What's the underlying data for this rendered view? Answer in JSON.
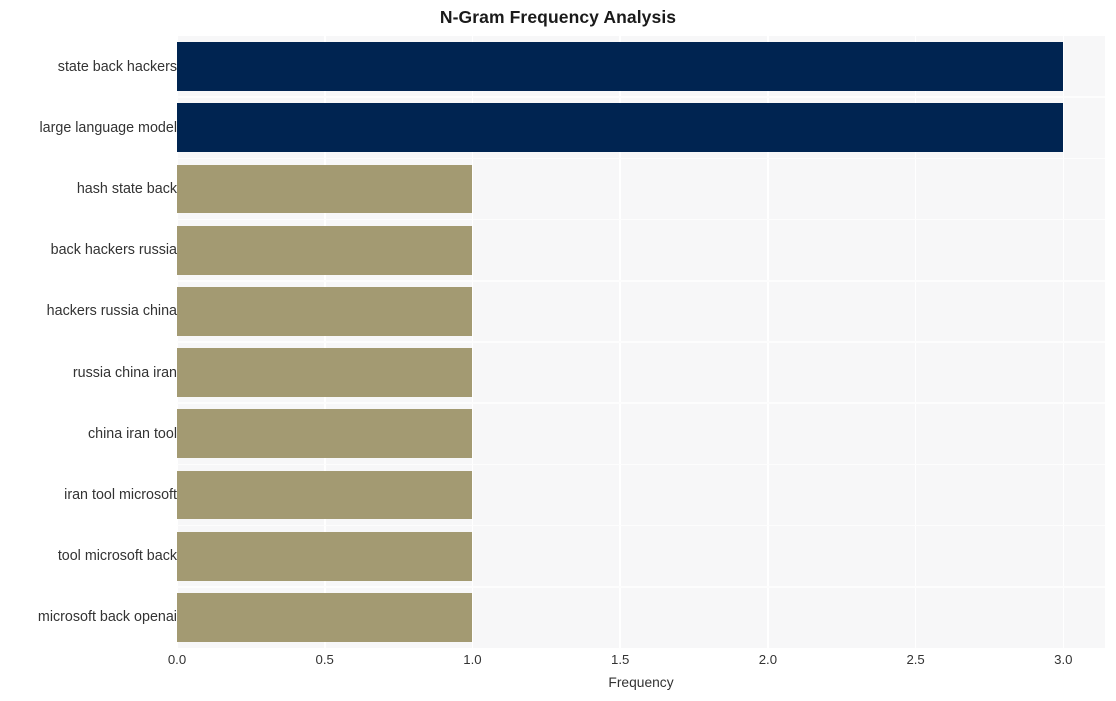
{
  "chart_data": {
    "type": "bar",
    "orientation": "horizontal",
    "title": "N-Gram Frequency Analysis",
    "xlabel": "Frequency",
    "ylabel": "",
    "categories": [
      "state back hackers",
      "large language model",
      "hash state back",
      "back hackers russia",
      "hackers russia china",
      "russia china iran",
      "china iran tool",
      "iran tool microsoft",
      "tool microsoft back",
      "microsoft back openai"
    ],
    "values": [
      3,
      3,
      1,
      1,
      1,
      1,
      1,
      1,
      1,
      1
    ],
    "bar_colors": [
      "#002451",
      "#002451",
      "#a39a72",
      "#a39a72",
      "#a39a72",
      "#a39a72",
      "#a39a72",
      "#a39a72",
      "#a39a72",
      "#a39a72"
    ],
    "xlim": [
      0,
      3.1410256410256414
    ],
    "xticks": [
      0,
      0.5,
      1,
      1.5,
      2,
      2.5,
      3
    ],
    "xtick_labels": [
      "0.0",
      "0.5",
      "1.0",
      "1.5",
      "2.0",
      "2.5",
      "3.0"
    ],
    "grid": true,
    "grid_color": "#ffffff",
    "legend": "none",
    "plot_background": "#f7f7f8",
    "figure_background": "#ffffff",
    "title_color": "#1a1a1a",
    "tick_label_color": "#333333"
  }
}
